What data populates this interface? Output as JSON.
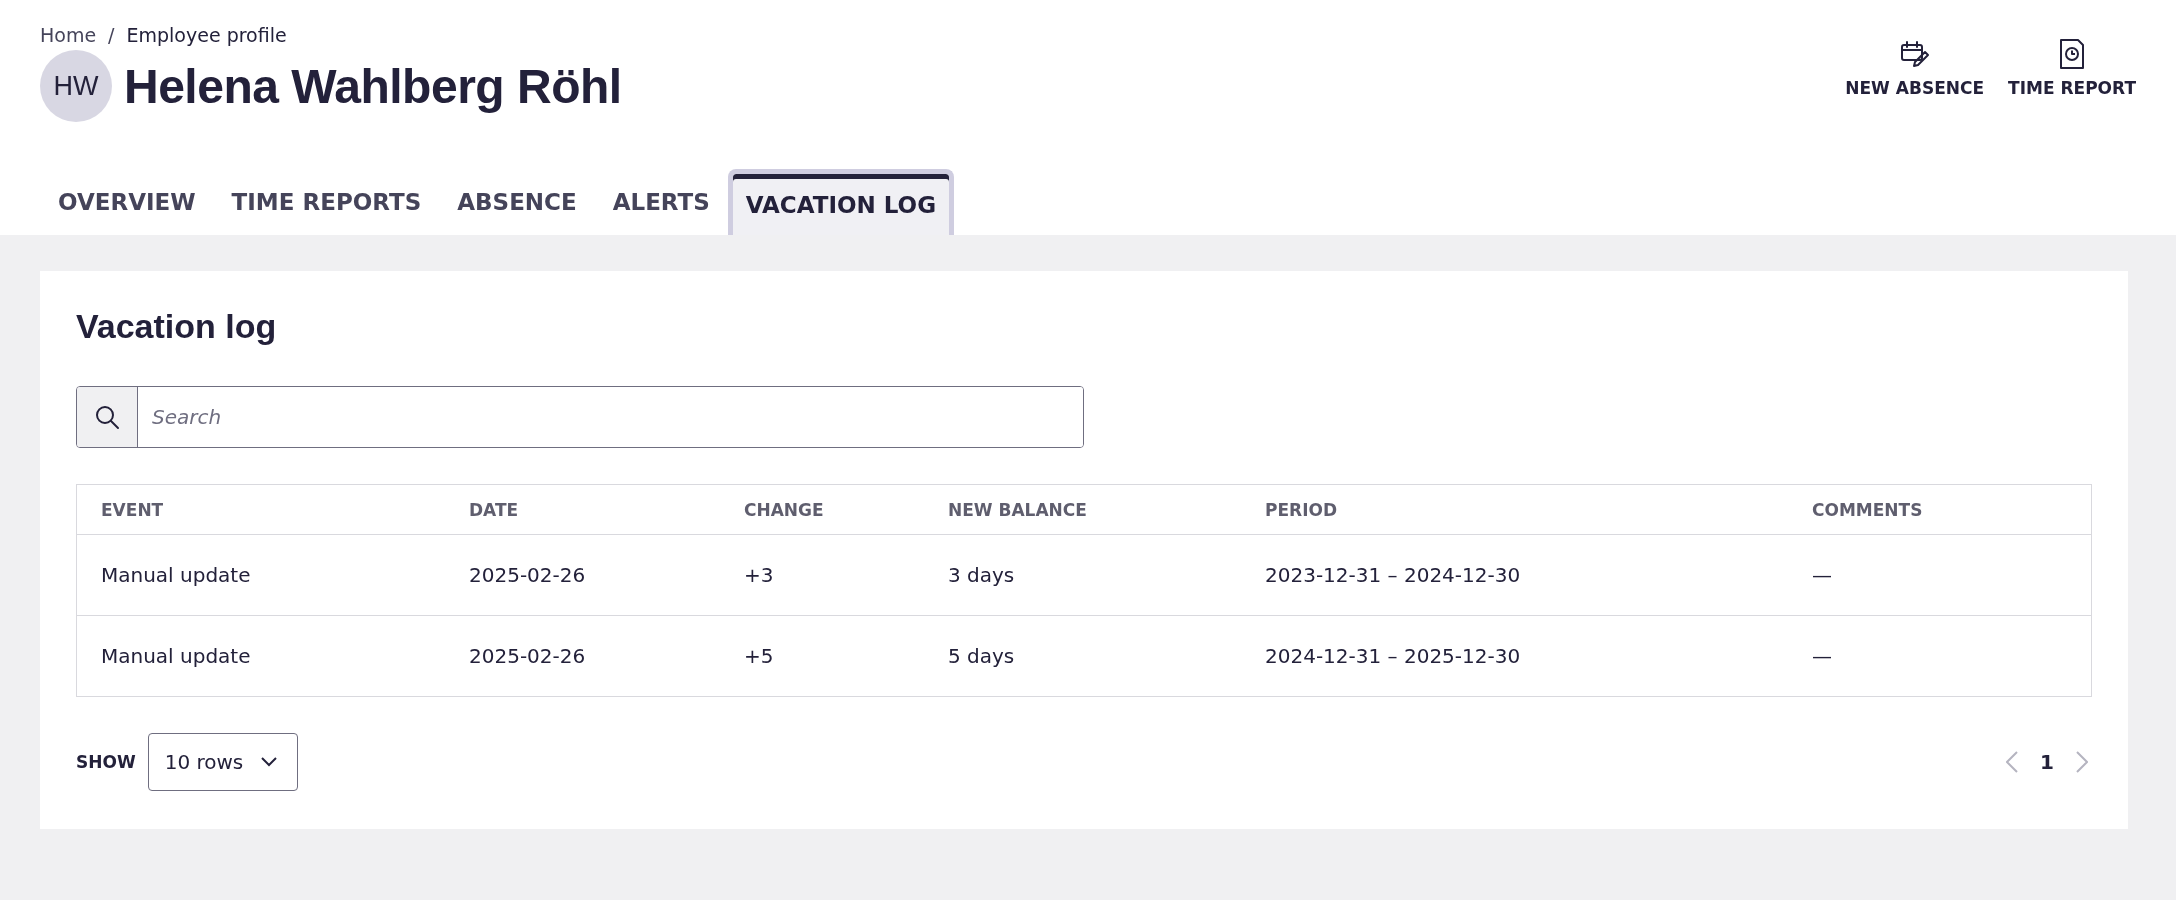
{
  "breadcrumb": {
    "items": [
      {
        "label": "Home"
      },
      {
        "label": "Employee profile"
      }
    ],
    "separator": "/"
  },
  "employee": {
    "initials": "HW",
    "name": "Helena Wahlberg Röhl"
  },
  "actions": [
    {
      "label": "NEW ABSENCE",
      "kind": "calendar-edit"
    },
    {
      "label": "TIME REPORT",
      "kind": "document-clock"
    }
  ],
  "tabs": [
    {
      "label": "OVERVIEW",
      "selected": false
    },
    {
      "label": "TIME REPORTS",
      "selected": false
    },
    {
      "label": "ABSENCE",
      "selected": false
    },
    {
      "label": "ALERTS",
      "selected": false
    },
    {
      "label": "VACATION LOG",
      "selected": true
    }
  ],
  "panel": {
    "title": "Vacation log",
    "search": {
      "placeholder": "Search"
    },
    "table": {
      "columns": [
        "EVENT",
        "DATE",
        "CHANGE",
        "NEW BALANCE",
        "PERIOD",
        "COMMENTS"
      ],
      "rows": [
        [
          "Manual update",
          "2025-02-26",
          "+3",
          "3 days",
          "2023-12-31 – 2024-12-30",
          "—"
        ],
        [
          "Manual update",
          "2025-02-26",
          "+5",
          "5 days",
          "2024-12-31 – 2025-12-30",
          "—"
        ]
      ]
    },
    "footer": {
      "show_label": "SHOW",
      "rows_select": "10 rows",
      "pages": [
        {
          "label": "1",
          "selected": true
        }
      ]
    }
  }
}
